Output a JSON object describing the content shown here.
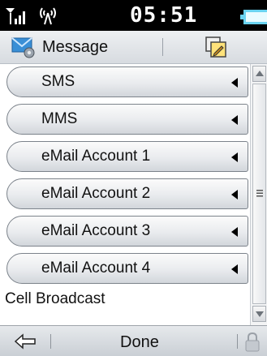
{
  "status_bar": {
    "time": "05:51",
    "signal_icon": "signal-bars-icon",
    "network_icon": "antenna-icon",
    "battery_icon": "battery-icon"
  },
  "title_bar": {
    "title": "Message",
    "app_icon": "message-settings-icon",
    "action_icon": "edit-document-icon"
  },
  "menu": {
    "items": [
      {
        "label": "SMS"
      },
      {
        "label": "MMS"
      },
      {
        "label": "eMail Account 1"
      },
      {
        "label": "eMail Account 2"
      },
      {
        "label": "eMail Account 3"
      },
      {
        "label": "eMail Account 4"
      }
    ],
    "plain_item": "Cell Broadcast"
  },
  "softkeys": {
    "back_icon": "back-arrow-icon",
    "center_label": "Done",
    "right_icon": "lock-icon"
  },
  "colors": {
    "status_bar_bg": "#000000",
    "accent_battery": "#6ad3f0",
    "item_border": "#7c838b"
  }
}
